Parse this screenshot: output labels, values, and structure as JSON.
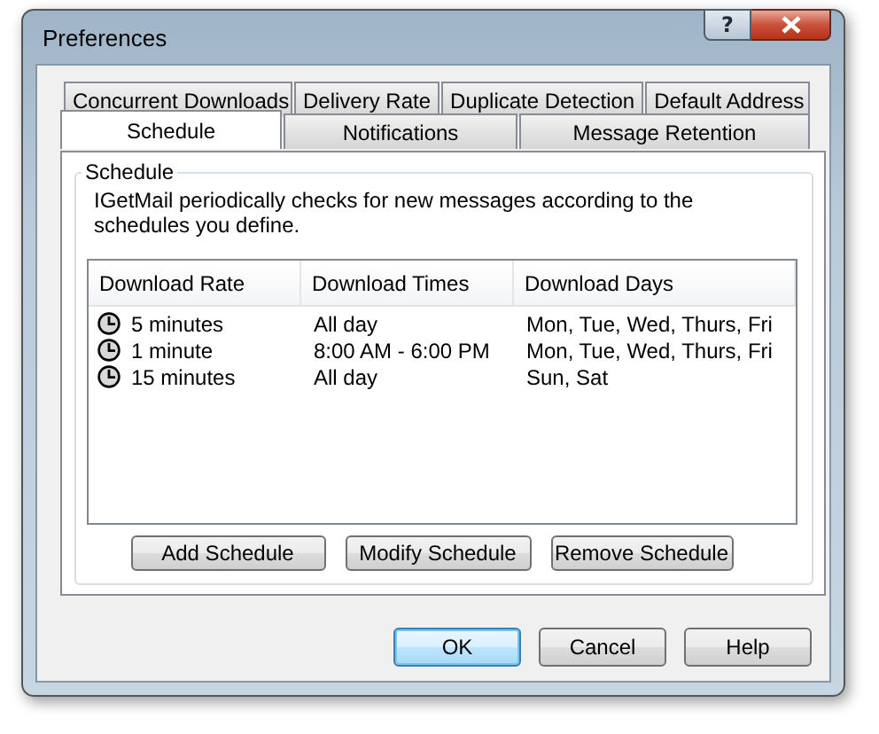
{
  "window": {
    "title": "Preferences",
    "help_button": "?"
  },
  "tab_rows": [
    [
      {
        "label": "Concurrent Downloads",
        "selected": false
      },
      {
        "label": "Delivery Rate",
        "selected": false
      },
      {
        "label": "Duplicate Detection",
        "selected": false
      },
      {
        "label": "Default Address",
        "selected": false
      }
    ],
    [
      {
        "label": "Schedule",
        "selected": true
      },
      {
        "label": "Notifications",
        "selected": false
      },
      {
        "label": "Message Retention",
        "selected": false
      }
    ]
  ],
  "group": {
    "title": "Schedule",
    "description": "IGetMail periodically checks for new messages according to the schedules you define."
  },
  "list": {
    "columns": [
      "Download Rate",
      "Download Times",
      "Download Days"
    ],
    "rows": [
      {
        "cells": [
          "5 minutes",
          "All day",
          "Mon, Tue, Wed, Thurs, Fri"
        ]
      },
      {
        "cells": [
          "1 minute",
          "8:00 AM - 6:00 PM",
          "Mon, Tue, Wed, Thurs, Fri"
        ]
      },
      {
        "cells": [
          "15 minutes",
          "All day",
          "Sun, Sat"
        ]
      }
    ]
  },
  "list_buttons": [
    "Add Schedule",
    "Modify Schedule",
    "Remove Schedule"
  ],
  "dialog_buttons": [
    {
      "label": "OK",
      "default": true
    },
    {
      "label": "Cancel",
      "default": false
    },
    {
      "label": "Help",
      "default": false
    }
  ]
}
